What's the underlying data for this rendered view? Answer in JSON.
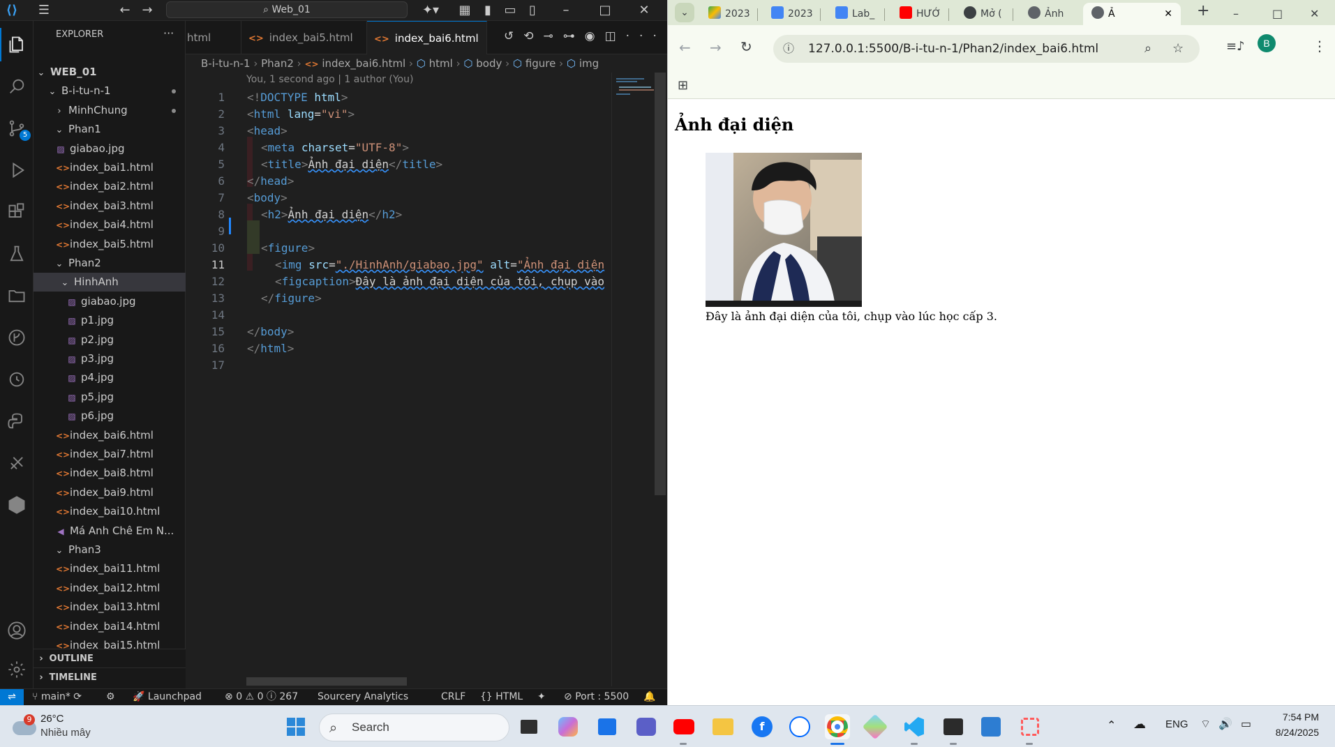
{
  "vscode": {
    "search_text": "Web_01",
    "explorer_title": "EXPLORER",
    "scm_badge": "5",
    "tree": [
      {
        "label": "WEB_01",
        "kind": "root"
      },
      {
        "label": "B-i-tu-n-1",
        "kind": "folder"
      },
      {
        "label": "MinhChung",
        "kind": "folder-collapsed"
      },
      {
        "label": "Phan1",
        "kind": "folder"
      },
      {
        "label": "giabao.jpg",
        "kind": "img"
      },
      {
        "label": "index_bai1.html",
        "kind": "html"
      },
      {
        "label": "index_bai2.html",
        "kind": "html"
      },
      {
        "label": "index_bai3.html",
        "kind": "html"
      },
      {
        "label": "index_bai4.html",
        "kind": "html"
      },
      {
        "label": "index_bai5.html",
        "kind": "html"
      },
      {
        "label": "Phan2",
        "kind": "folder"
      },
      {
        "label": "HinhAnh",
        "kind": "folder"
      },
      {
        "label": "giabao.jpg",
        "kind": "img"
      },
      {
        "label": "p1.jpg",
        "kind": "img"
      },
      {
        "label": "p2.jpg",
        "kind": "img"
      },
      {
        "label": "p3.jpg",
        "kind": "img"
      },
      {
        "label": "p4.jpg",
        "kind": "img"
      },
      {
        "label": "p5.jpg",
        "kind": "img"
      },
      {
        "label": "p6.jpg",
        "kind": "img"
      },
      {
        "label": "index_bai6.html",
        "kind": "html"
      },
      {
        "label": "index_bai7.html",
        "kind": "html"
      },
      {
        "label": "index_bai8.html",
        "kind": "html"
      },
      {
        "label": "index_bai9.html",
        "kind": "html"
      },
      {
        "label": "index_bai10.html",
        "kind": "html"
      },
      {
        "label": "Má Anh Chê Em N...",
        "kind": "media"
      },
      {
        "label": "Phan3",
        "kind": "folder"
      },
      {
        "label": "index_bai11.html",
        "kind": "html"
      },
      {
        "label": "index_bai12.html",
        "kind": "html"
      },
      {
        "label": "index_bai13.html",
        "kind": "html"
      },
      {
        "label": "index_bai14.html",
        "kind": "html"
      },
      {
        "label": "index_bai15.html",
        "kind": "html"
      }
    ],
    "outline_label": "OUTLINE",
    "timeline_label": "TIMELINE",
    "tabs": [
      "html",
      "index_bai5.html",
      "index_bai6.html"
    ],
    "breadcrumb": [
      "B-i-tu-n-1",
      "Phan2",
      "index_bai6.html",
      "html",
      "body",
      "figure",
      "img"
    ],
    "blame": "You, 1 second ago | 1 author (You)",
    "line_numbers": [
      "1",
      "2",
      "3",
      "4",
      "5",
      "6",
      "7",
      "8",
      "9",
      "10",
      "11",
      "12",
      "13",
      "14",
      "15",
      "16",
      "17"
    ],
    "code": {
      "l1_a": "<!",
      "l1_b": "DOCTYPE",
      "l1_c": " html",
      "l1_d": ">",
      "l2_attr": "lang",
      "l2_val": "\"vi\"",
      "l4_attr": "charset",
      "l4_val": "\"UTF-8\"",
      "l5_text": "Ảnh đại diện",
      "l8_text": "Ảnh đại diện",
      "l11_src": "\"./HinhAnh/giabao.jpg\"",
      "l11_alt": "\"Ảnh đại diện",
      "l12_text": "Đây là ảnh đại diện của tôi, chụp vào"
    },
    "status": {
      "branch": "main*",
      "launchpad": "Launchpad",
      "problems": "0",
      "warnings": "0",
      "infos": "267",
      "sourcery": "Sourcery Analytics",
      "eol": "CRLF",
      "language": "HTML",
      "port": "Port : 5500"
    }
  },
  "browser": {
    "tabs": [
      "2023",
      "2023",
      "Lab_",
      "HƯỚ",
      "Mở (",
      "Ảnh",
      "Ả"
    ],
    "url": "127.0.0.1:5500/B-i-tu-n-1/Phan2/index_bai6.html",
    "profile_initial": "B",
    "page": {
      "heading": "Ảnh đại diện",
      "caption": "Đây là ảnh đại diện của tôi, chụp vào lúc học cấp 3."
    }
  },
  "taskbar": {
    "weather_badge": "9",
    "temperature": "26°C",
    "weather_desc": "Nhiều mây",
    "search_placeholder": "Search",
    "language": "ENG",
    "time": "7:54 PM",
    "date": "8/24/2025"
  }
}
